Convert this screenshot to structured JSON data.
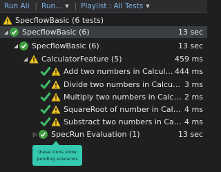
{
  "toolbar": {
    "run_all": "Run All",
    "run": "Run...",
    "playlist": "Playlist : All Tests"
  },
  "summary": {
    "label": "SpecflowBasic (6 tests)"
  },
  "tree": {
    "solution": {
      "label": "SpecflowBasic (6)",
      "duration": "13 sec"
    },
    "project": {
      "label": "SpecflowBasic (6)",
      "duration": "13 sec"
    },
    "feature": {
      "label": "CalculatorFeature (5)",
      "duration": "459 ms"
    },
    "tests": [
      {
        "label": "Add two numbers in Calculator...",
        "duration": "444 ms"
      },
      {
        "label": "Divide two numbers in Calculator...",
        "duration": "3 ms"
      },
      {
        "label": "Multiply two numbers in Calculat...",
        "duration": "2 ms"
      },
      {
        "label": "SquareRoot of number in Calcula...",
        "duration": "4 ms"
      },
      {
        "label": "Substract two numbers in Calcula...",
        "duration": "4 ms"
      }
    ],
    "group": {
      "label": "SpecRun Evaluation (1)",
      "duration": "13 sec"
    }
  },
  "callout": {
    "text": "these icons show pending scenarios"
  },
  "colors": {
    "pass": "#3f9b3f",
    "pending": "#f0c419",
    "callout": "#35c9b0",
    "accent": "#7fb2e5"
  }
}
